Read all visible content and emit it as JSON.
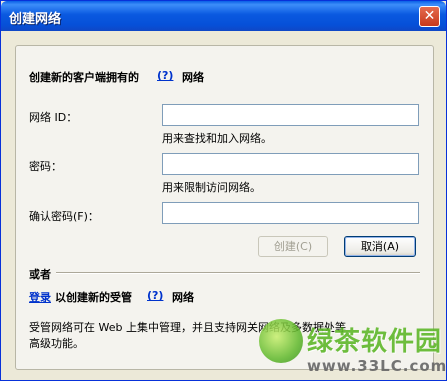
{
  "window": {
    "title": "创建网络",
    "close_glyph": "✕"
  },
  "create_section": {
    "intro_prefix": "创建新的客户端拥有的",
    "help_label": "(?)",
    "intro_suffix": "网络",
    "network_id": {
      "label": "网络 ID：",
      "value": "",
      "hint": "用来查找和加入网络。"
    },
    "password": {
      "label": "密码：",
      "value": "",
      "hint": "用来限制访问网络。"
    },
    "confirm_password": {
      "label": "确认密码(F)：",
      "value": ""
    },
    "create_button": "创建(C)",
    "cancel_button": "取消(A)"
  },
  "or_section": {
    "or_label": "或者",
    "login_link": "登录",
    "login_suffix": "以创建新的受管",
    "help_label": "(?)",
    "network_label": "网络",
    "description_line1": "受管网络可在 Web 上集中管理，并且支持网关网络及多数据处等",
    "description_line2": "高级功能。"
  },
  "watermark": {
    "title": "绿茶软件园",
    "url": "www.33LC.com"
  }
}
